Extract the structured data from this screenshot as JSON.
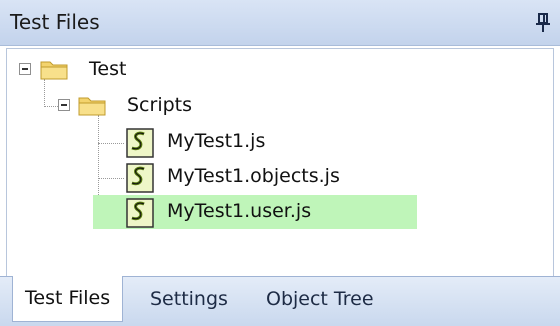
{
  "panel": {
    "title": "Test Files",
    "pin_icon": "pin-icon"
  },
  "tree": {
    "nodes": [
      {
        "label": "Test",
        "icon": "folder-icon",
        "expanded": true
      },
      {
        "label": "Scripts",
        "icon": "folder-icon",
        "expanded": true
      },
      {
        "label": "MyTest1.js",
        "icon": "script-icon"
      },
      {
        "label": "MyTest1.objects.js",
        "icon": "script-icon"
      },
      {
        "label": "MyTest1.user.js",
        "icon": "script-icon",
        "selected": true
      }
    ]
  },
  "tabs": [
    {
      "label": "Test Files",
      "active": true
    },
    {
      "label": "Settings"
    },
    {
      "label": "Object Tree"
    }
  ],
  "colors": {
    "selection": "#bff5b9",
    "title_bar": "#c3d3ec"
  }
}
